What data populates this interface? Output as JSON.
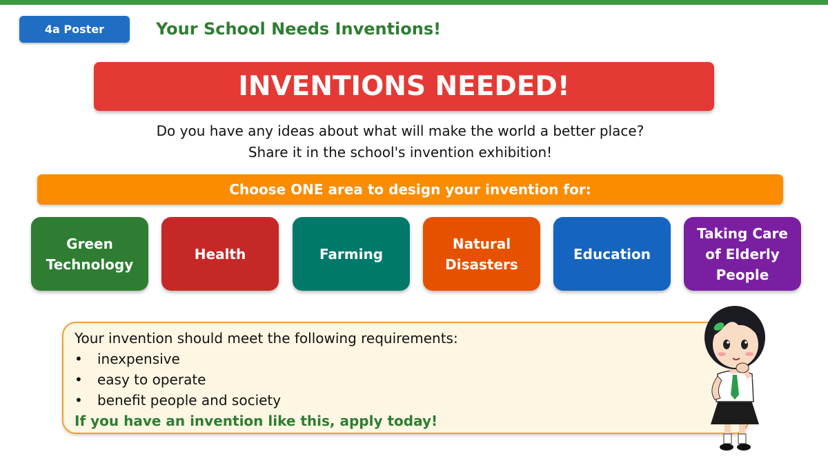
{
  "header": {
    "tag": "4a Poster",
    "title": "Your School Needs Inventions!"
  },
  "banner": "INVENTIONS NEEDED!",
  "intro": {
    "line1": "Do you have any ideas about what will make the world a better place?",
    "line2": "Share it in the school's invention exhibition!"
  },
  "choose": "Choose ONE area to design your invention for:",
  "areas": [
    {
      "line1": "Green",
      "line2": "Technology",
      "color": "#2e7d32"
    },
    {
      "line1": "Health",
      "color": "#c62828"
    },
    {
      "line1": "Farming",
      "color": "#00796b"
    },
    {
      "line1": "Natural",
      "line2": "Disasters",
      "color": "#e65100"
    },
    {
      "line1": "Education",
      "color": "#1565c0"
    },
    {
      "line1": "Taking Care",
      "line2": "of Elderly",
      "line3": "People",
      "color": "#7b1fa2"
    }
  ],
  "requirements": {
    "title": "Your invention should meet the following requirements:",
    "bullet": "•",
    "items": [
      "inexpensive",
      "easy to operate",
      "benefit people and society"
    ],
    "call_to_action": "If you have an invention like this, apply today!"
  },
  "colors": {
    "accent_green": "#2e7d32",
    "banner_red": "#e53935",
    "orange": "#fb8c00",
    "box_border": "#f0a030"
  },
  "illustration": {
    "icon": "thinking-girl-icon"
  }
}
